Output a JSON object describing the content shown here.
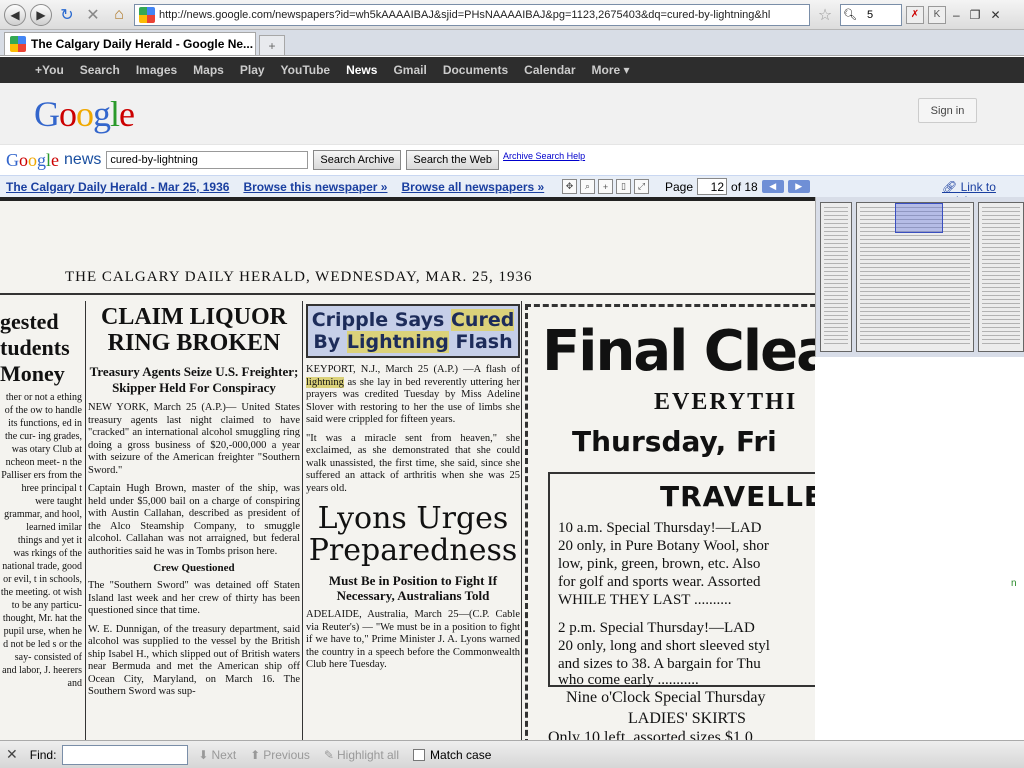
{
  "browser": {
    "url": "http://news.google.com/newspapers?id=wh5kAAAAIBAJ&sjid=PHsNAAAAIBAJ&pg=1123,2675403&dq=cured-by-lightning&hl",
    "tab_title": "The Calgary Daily Herald - Google Ne...",
    "search_value": "5",
    "icons": [
      "back-icon",
      "forward-icon",
      "reload-icon",
      "stop-icon",
      "home-icon",
      "bookmark-star-icon",
      "search-icon",
      "magnifier-icon",
      "new-tab-icon",
      "minimize-icon",
      "restore-icon",
      "close-icon"
    ]
  },
  "gbar": {
    "items": [
      "+You",
      "Search",
      "Images",
      "Maps",
      "Play",
      "YouTube",
      "News",
      "Gmail",
      "Documents",
      "Calendar",
      "More ▾"
    ],
    "active_index": 6
  },
  "header": {
    "logo": "Google",
    "sign_in": "Sign in"
  },
  "search": {
    "logo_google": "Google",
    "logo_news": "news",
    "query": "cured-by-lightning",
    "btn_archive": "Search Archive",
    "btn_web": "Search the Web",
    "help_link": "Archive Search Help"
  },
  "viewer": {
    "paper_link": "The Calgary Daily Herald - Mar 25, 1936",
    "browse_paper": "Browse this newspaper »",
    "browse_all": "Browse all newspapers »",
    "page_label": "Page",
    "page_value": "12",
    "page_total": "of 18",
    "link_article": "Link to article"
  },
  "newspaper": {
    "masthead": "THE CALGARY DAILY HERALD, WEDNESDAY, MAR. 25, 1936",
    "col1_head": [
      "gested",
      "tudents",
      "Money"
    ],
    "col1_text": "ther or not a ething of the ow to handle its functions, ed in the cur- ing grades, was otary Club at ncheon meet- n the Palliser ers from the hree principal t were taught grammar, and hool, learned imilar things and yet it was rkings of the national trade, good or evil, t in schools, the meeting. ot wish to be any particu- thought, Mr. hat the pupil urse, when he d not be led s or the say- consisted of and labor, J. heerers and",
    "col2_head": "CLAIM LIQUOR RING BROKEN",
    "col2_sub": "Treasury Agents Seize U.S. Freighter; Skipper Held For Conspiracy",
    "col2_p1": "NEW YORK, March 25 (A.P.)— United States treasury agents last night claimed to have \"cracked\" an international alcohol smuggling ring doing a gross business of $20,-000,000 a year with seizure of the American freighter \"Southern Sword.\"",
    "col2_p2": "Captain Hugh Brown, master of the ship, was held under $5,000 bail on a charge of conspiring with Austin Callahan, described as president of the Alco Steamship Company, to smuggle alcohol. Callahan was not arraigned, but federal authorities said he was in Tombs prison here.",
    "col2_subhead": "Crew Questioned",
    "col2_p3": "The \"Southern Sword\" was detained off Staten Island last week and her crew of thirty has been questioned since that time.",
    "col2_p4": "W. E. Dunnigan, of the treasury department, said alcohol was supplied to the vessel by the British ship Isabel H., which slipped out of British waters near Bermuda and met the American ship off Ocean City, Maryland, on March 16. The Southern Sword was sup-",
    "col3_box_a": "Cripple Says",
    "col3_box_b": "Cured",
    "col3_box_c": "By",
    "col3_box_d": "Lightning",
    "col3_box_e": "Flash",
    "col3_p1a": "KEYPORT, N.J., March 25 (A.P.) —A flash of",
    "col3_p1hl": "lightning",
    "col3_p1b": "as she lay in bed reverently uttering her prayers was credited Tuesday by Miss Adeline Slover with restoring to her the use of limbs she said were crippled for fifteen years.",
    "col3_p2": "\"It was a miracle sent from heaven,\" she exclaimed, as she demonstrated that she could walk unassisted, the first time, she said, since she suffered an attack of arthritis when she was 25 years old.",
    "col3_head": "Lyons Urges Preparedness",
    "col3_sub": "Must Be in Position to Fight If Necessary, Australians Told",
    "col3_p3": "ADELAIDE, Australia, March 25—(C.P. Cable via Reuter's) — \"We must be in a position to fight if we have to,\" Prime Minister J. A. Lyons warned the country in a speech before the Commonwealth Club here Tuesday.",
    "ad_big": "Final Clearan",
    "ad_every": "EVERYTHI",
    "ad_thurs": "Thursday, Fri",
    "ad_trav": "TRAVELLE",
    "ad_lines": [
      "10 a.m. Special Thursday!—LAD",
      "20 only, in Pure Botany Wool, shor",
      "low, pink, green, brown, etc. Also",
      "for golf and sports wear. Assorted",
      "WHILE THEY LAST ..........",
      "2 p.m. Special Thursday!—LAD",
      "20 only, long and short sleeved styl",
      "and sizes to 38. A bargain for Thu",
      "who come early ..........."
    ],
    "ad_nine": "Nine o'Clock Special Thursday",
    "ad_skirts": "LADIES' SKIRTS",
    "ad_only": "Only 10 left, assorted sizes $1.0"
  },
  "side_mark": "n",
  "find": {
    "label": "Find:",
    "next": "Next",
    "previous": "Previous",
    "highlight": "Highlight all",
    "match_case": "Match case"
  }
}
